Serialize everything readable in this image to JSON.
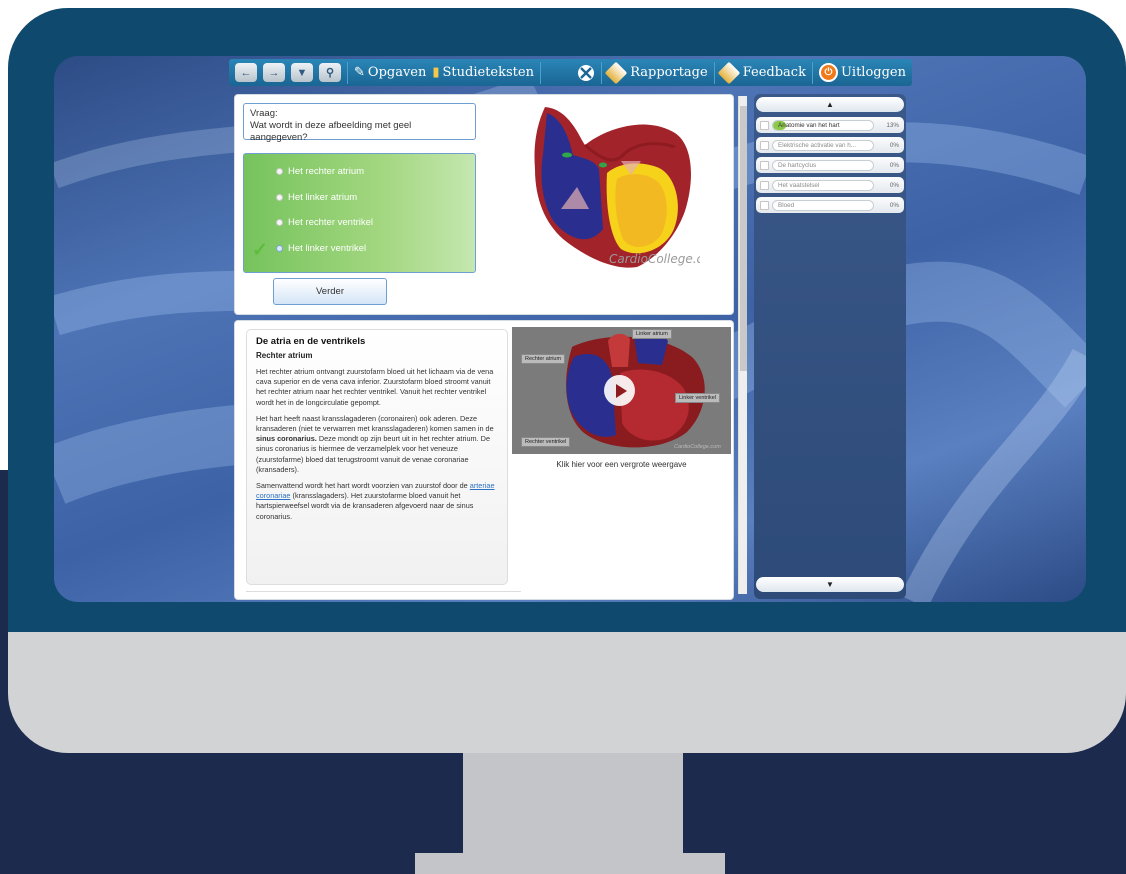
{
  "toolbar": {
    "back_icon": "arrow-left-icon",
    "forward_icon": "arrow-right-icon",
    "dropdown_icon": "chevron-down-icon",
    "search_icon": "magnifier-icon",
    "opgaven": "Opgaven",
    "studieteksten": "Studieteksten",
    "rapportage": "Rapportage",
    "feedback": "Feedback",
    "uitloggen": "Uitloggen"
  },
  "question": {
    "label": "Vraag:",
    "text": "Wat wordt in deze afbeelding met geel aangegeven?",
    "answers": [
      "Het rechter atrium",
      "Het linker atrium",
      "Het rechter ventrikel",
      "Het linker ventrikel"
    ],
    "correct_index": 3,
    "next_button": "Verder",
    "image_watermark": "CardioCollege.com"
  },
  "article": {
    "title": "De atria en de ventrikels",
    "subtitle": "Rechter atrium",
    "p1": "Het rechter atrium ontvangt zuurstofarm bloed uit het lichaam via de vena cava superior en de vena cava inferior. Zuurstofarm bloed stroomt vanuit het rechter atrium naar het rechter ventrikel. Vanuit het rechter ventrikel wordt het in de longcirculatie gepompt.",
    "p2a": "Het hart heeft naast kransslagaderen (coronairen) ook aderen. Deze kransaderen (niet te verwarren met kransslagaderen) komen samen in de ",
    "p2b": "sinus coronarius.",
    "p2c": " Deze mondt op zijn beurt uit in het rechter atrium. De sinus coronarius is hiermee de verzamelplek voor het veneuze (zuurstofarme) bloed dat terugstroomt vanuit de venae coronariae (kransaders).",
    "p3a": "Samenvattend wordt het hart wordt voorzien van zuurstof door de ",
    "p3link": "arteriae coronariae",
    "p3b": " (kransslagaders). Het zuurstofarme bloed vanuit het hartspierweefsel wordt via de kransaderen afgevoerd naar de sinus coronarius."
  },
  "video": {
    "labels": {
      "linker_atrium": "Linker atrium",
      "rechter_atrium": "Rechter atrium",
      "linker_ventrikel": "Linker ventrikel",
      "rechter_ventrikel": "Rechter ventrikel"
    },
    "watermark": "CardioCollege.com",
    "caption": "Klik hier voor een vergrote weergave"
  },
  "sidebar": {
    "up_arrow": "▲",
    "down_arrow": "▼",
    "chapters": [
      {
        "title": "Anatomie van het hart",
        "percent": "13%",
        "progress": 0.13
      },
      {
        "title": "Elektrische activatie van h...",
        "percent": "0%",
        "progress": 0
      },
      {
        "title": "De hartcyclus",
        "percent": "0%",
        "progress": 0
      },
      {
        "title": "Het vaatstelsel",
        "percent": "0%",
        "progress": 0
      },
      {
        "title": "Bloed",
        "percent": "0%",
        "progress": 0
      }
    ]
  },
  "colors": {
    "bezel_top": "#0f4a6e",
    "bezel_bottom": "#d2d3d5",
    "toolbar": "#1a6593",
    "answers_green": "#76c35d",
    "heart_red": "#a3232a",
    "heart_blue": "#2a2f8f",
    "heart_yellow": "#f6d21a"
  }
}
